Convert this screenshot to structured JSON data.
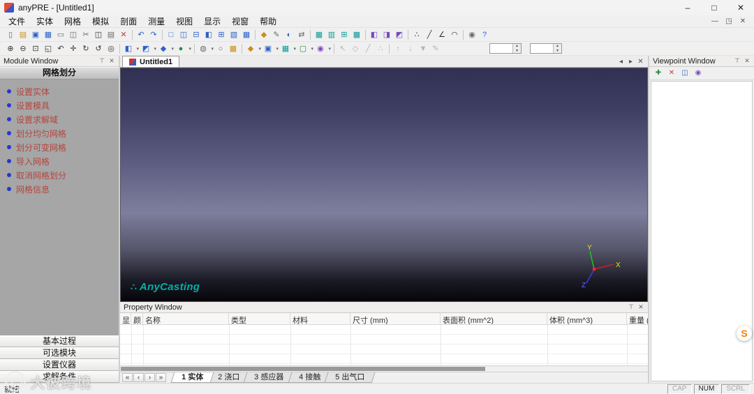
{
  "window": {
    "title": "anyPRE - [Untitled1]",
    "controls": {
      "minimize": "–",
      "maximize": "□",
      "close": "✕"
    }
  },
  "menu": {
    "items": [
      "文件",
      "实体",
      "网格",
      "模拟",
      "剖面",
      "测量",
      "视图",
      "显示",
      "视窗",
      "帮助"
    ],
    "mdi_controls": {
      "minimize": "—",
      "restore": "◳",
      "close": "✕"
    }
  },
  "toolbar1": {
    "items": [
      {
        "name": "new-file-icon",
        "g": "▯",
        "cls": "tb-icon c-dim",
        "ia": "true"
      },
      {
        "name": "open-file-icon",
        "g": "▤",
        "cls": "tb-icon c-yellow",
        "ia": "true"
      },
      {
        "name": "save-icon",
        "g": "▣",
        "cls": "tb-icon c-blue",
        "ia": "true"
      },
      {
        "name": "save-all-icon",
        "g": "▦",
        "cls": "tb-icon c-blue",
        "ia": "true"
      },
      {
        "name": "print-icon",
        "g": "▭",
        "cls": "tb-icon c-dim",
        "ia": "true"
      },
      {
        "name": "print-preview-icon",
        "g": "◫",
        "cls": "tb-icon c-dim",
        "ia": "true"
      },
      {
        "name": "cut-icon",
        "g": "✂",
        "cls": "tb-icon c-dim",
        "ia": "true"
      },
      {
        "name": "copy-icon",
        "g": "◫",
        "cls": "tb-icon c-dark",
        "ia": "true"
      },
      {
        "name": "paste-icon",
        "g": "▤",
        "cls": "tb-icon c-dim",
        "ia": "true"
      },
      {
        "name": "delete-icon",
        "g": "✕",
        "cls": "tb-icon c-red",
        "ia": "true"
      },
      {
        "name": "toolbar-separator",
        "g": "",
        "cls": "tb-sep",
        "ia": "false"
      },
      {
        "name": "undo-icon",
        "g": "↶",
        "cls": "tb-icon c-blue",
        "ia": "true"
      },
      {
        "name": "redo-icon",
        "g": "↷",
        "cls": "tb-icon c-blue",
        "ia": "true"
      },
      {
        "name": "toolbar-separator",
        "g": "",
        "cls": "tb-sep",
        "ia": "false"
      },
      {
        "name": "single-view-icon",
        "g": "□",
        "cls": "tb-icon c-blue",
        "ia": "true"
      },
      {
        "name": "two-view-vertical-icon",
        "g": "◫",
        "cls": "tb-icon c-blue",
        "ia": "true"
      },
      {
        "name": "two-view-horizontal-icon",
        "g": "⊟",
        "cls": "tb-icon c-blue",
        "ia": "true"
      },
      {
        "name": "three-view-icon",
        "g": "◧",
        "cls": "tb-icon c-blue",
        "ia": "true"
      },
      {
        "name": "four-view-icon",
        "g": "⊞",
        "cls": "tb-icon c-blue",
        "ia": "true"
      },
      {
        "name": "cascade-windows-icon",
        "g": "▧",
        "cls": "tb-icon c-blue",
        "ia": "true"
      },
      {
        "name": "tile-windows-icon",
        "g": "▦",
        "cls": "tb-icon c-blue",
        "ia": "true"
      },
      {
        "name": "toolbar-separator",
        "g": "",
        "cls": "tb-sep",
        "ia": "false"
      },
      {
        "name": "create-entity-icon",
        "g": "◆",
        "cls": "tb-icon c-yellow",
        "ia": "true"
      },
      {
        "name": "edit-entity-icon",
        "g": "✎",
        "cls": "tb-icon c-dim",
        "ia": "true"
      },
      {
        "name": "boolean-operation-icon",
        "g": "◐",
        "cls": "tb-icon c-blue",
        "ia": "true"
      },
      {
        "name": "transform-entity-icon",
        "g": "⇄",
        "cls": "tb-icon c-dim",
        "ia": "true"
      },
      {
        "name": "toolbar-separator",
        "g": "",
        "cls": "tb-sep",
        "ia": "false"
      },
      {
        "name": "uniform-mesh-icon",
        "g": "▦",
        "cls": "tb-icon c-teal",
        "ia": "true"
      },
      {
        "name": "variable-mesh-icon",
        "g": "▥",
        "cls": "tb-icon c-teal",
        "ia": "true"
      },
      {
        "name": "import-mesh-icon",
        "g": "⊞",
        "cls": "tb-icon c-teal",
        "ia": "true"
      },
      {
        "name": "mesh-info-icon",
        "g": "▩",
        "cls": "tb-icon c-teal",
        "ia": "true"
      },
      {
        "name": "toolbar-separator",
        "g": "",
        "cls": "tb-sep",
        "ia": "false"
      },
      {
        "name": "section-x-icon",
        "g": "◧",
        "cls": "tb-icon c-purple",
        "ia": "true"
      },
      {
        "name": "section-y-icon",
        "g": "◨",
        "cls": "tb-icon c-purple",
        "ia": "true"
      },
      {
        "name": "section-z-icon",
        "g": "◩",
        "cls": "tb-icon c-purple",
        "ia": "true"
      },
      {
        "name": "toolbar-separator",
        "g": "",
        "cls": "tb-sep",
        "ia": "false"
      },
      {
        "name": "measure-point-icon",
        "g": "∴",
        "cls": "tb-icon c-dark",
        "ia": "true"
      },
      {
        "name": "measure-line-icon",
        "g": "╱",
        "cls": "tb-icon c-dark",
        "ia": "true"
      },
      {
        "name": "measure-angle-icon",
        "g": "∠",
        "cls": "tb-icon c-dark",
        "ia": "true"
      },
      {
        "name": "measure-radius-icon",
        "g": "◠",
        "cls": "tb-icon c-dark",
        "ia": "true"
      },
      {
        "name": "toolbar-separator",
        "g": "",
        "cls": "tb-sep",
        "ia": "false"
      },
      {
        "name": "snapshot-icon",
        "g": "◉",
        "cls": "tb-icon c-dim",
        "ia": "true"
      },
      {
        "name": "help-icon",
        "g": "?",
        "cls": "tb-icon c-blue",
        "ia": "true"
      }
    ]
  },
  "toolbar2": {
    "spin_up": "▴",
    "spin_down": "▾",
    "items": [
      {
        "name": "zoom-in-icon",
        "g": "⊕",
        "cls": "tb-icon c-dark",
        "ia": "true"
      },
      {
        "name": "zoom-out-icon",
        "g": "⊖",
        "cls": "tb-icon c-dark",
        "ia": "true"
      },
      {
        "name": "zoom-window-icon",
        "g": "⊡",
        "cls": "tb-icon c-dark",
        "ia": "true"
      },
      {
        "name": "zoom-extents-icon",
        "g": "◱",
        "cls": "tb-icon c-dark",
        "ia": "true"
      },
      {
        "name": "zoom-previous-icon",
        "g": "↶",
        "cls": "tb-icon c-dark",
        "ia": "true"
      },
      {
        "name": "pan-icon",
        "g": "✛",
        "cls": "tb-icon c-dark",
        "ia": "true"
      },
      {
        "name": "rotate-view-icon",
        "g": "↻",
        "cls": "tb-icon c-dark",
        "ia": "true"
      },
      {
        "name": "spin-view-icon",
        "g": "↺",
        "cls": "tb-icon c-dark",
        "ia": "true"
      },
      {
        "name": "center-view-icon",
        "g": "◎",
        "cls": "tb-icon c-dark",
        "ia": "true"
      },
      {
        "name": "toolbar-separator",
        "g": "",
        "cls": "tb-sep",
        "ia": "false"
      },
      {
        "name": "front-view-icon",
        "g": "◧",
        "cls": "tb-icon dd c-blue",
        "ia": "true"
      },
      {
        "name": "top-view-icon",
        "g": "◩",
        "cls": "tb-icon dd c-blue",
        "ia": "true"
      },
      {
        "name": "iso-view-icon",
        "g": "◆",
        "cls": "tb-icon dd c-blue",
        "ia": "true"
      },
      {
        "name": "render-mode-icon",
        "g": "●",
        "cls": "tb-icon dd c-green",
        "ia": "true"
      },
      {
        "name": "toolbar-separator",
        "g": "",
        "cls": "tb-sep",
        "ia": "false"
      },
      {
        "name": "shade-mode-icon",
        "g": "◍",
        "cls": "tb-icon dd c-dim",
        "ia": "true"
      },
      {
        "name": "wireframe-icon",
        "g": "○",
        "cls": "tb-icon c-dim",
        "ia": "true"
      },
      {
        "name": "texture-icon",
        "g": "▩",
        "cls": "tb-icon c-yellow",
        "ia": "true"
      },
      {
        "name": "toolbar-separator",
        "g": "",
        "cls": "tb-sep",
        "ia": "false"
      },
      {
        "name": "display-entity-icon",
        "g": "◆",
        "cls": "tb-icon dd c-yellow",
        "ia": "true"
      },
      {
        "name": "display-mold-icon",
        "g": "▣",
        "cls": "tb-icon dd c-blue",
        "ia": "true"
      },
      {
        "name": "display-mesh-icon",
        "g": "▦",
        "cls": "tb-icon dd c-teal",
        "ia": "true"
      },
      {
        "name": "display-domain-icon",
        "g": "▢",
        "cls": "tb-icon dd c-green",
        "ia": "true"
      },
      {
        "name": "display-all-icon",
        "g": "◉",
        "cls": "tb-icon dd c-purple",
        "ia": "true"
      },
      {
        "name": "toolbar-separator",
        "g": "",
        "cls": "tb-sep",
        "ia": "false"
      },
      {
        "name": "select-entity-icon",
        "g": "↖",
        "cls": "tb-icon c-dis",
        "ia": "true"
      },
      {
        "name": "select-face-icon",
        "g": "◇",
        "cls": "tb-icon c-dis",
        "ia": "true"
      },
      {
        "name": "select-edge-icon",
        "g": "╱",
        "cls": "tb-icon c-dis",
        "ia": "true"
      },
      {
        "name": "select-vertex-icon",
        "g": "∴",
        "cls": "tb-icon c-dis",
        "ia": "true"
      },
      {
        "name": "toolbar-separator",
        "g": "",
        "cls": "tb-sep",
        "ia": "false"
      },
      {
        "name": "move-up-icon",
        "g": "↑",
        "cls": "tb-icon c-dis",
        "ia": "true"
      },
      {
        "name": "move-down-icon",
        "g": "↓",
        "cls": "tb-icon c-dis",
        "ia": "true"
      },
      {
        "name": "filter-icon",
        "g": "▼",
        "cls": "tb-icon c-dis",
        "ia": "true"
      },
      {
        "name": "edit-list-icon",
        "g": "✎",
        "cls": "tb-icon c-dis",
        "ia": "true"
      }
    ]
  },
  "module_window": {
    "title": "Module Window",
    "header": "网格划分",
    "items": [
      "设置实体",
      "设置模具",
      "设置求解域",
      "划分均匀网格",
      "划分可变网格",
      "导入网格",
      "取消网格划分",
      "网格信息"
    ],
    "bottom_buttons": [
      "基本过程",
      "可选模块",
      "设置仪器",
      "求解条件"
    ]
  },
  "viewport": {
    "tab": "Untitled1",
    "tab_controls": {
      "left": "◂",
      "right": "▸",
      "close": "✕"
    },
    "logo_mark": "∴",
    "logo": "AnyCasting",
    "axes": {
      "x": "X",
      "y": "Y",
      "z": "Z"
    }
  },
  "viewpoint_window": {
    "title": "Viewpoint Window",
    "toolbar": [
      {
        "name": "new-viewpoint-icon",
        "g": "✚",
        "cls": "vp-icon c-green",
        "ia": "true"
      },
      {
        "name": "delete-viewpoint-icon",
        "g": "✕",
        "cls": "vp-icon c-red",
        "ia": "true"
      },
      {
        "name": "copy-viewpoint-icon",
        "g": "◫",
        "cls": "vp-icon c-blue",
        "ia": "true"
      },
      {
        "name": "capture-viewpoint-icon",
        "g": "◉",
        "cls": "vp-icon c-purple",
        "ia": "true"
      }
    ]
  },
  "property_window": {
    "title": "Property Window",
    "columns": [
      "显",
      "颜",
      "名称",
      "类型",
      "材料",
      "尺寸 (mm)",
      "表面积 (mm^2)",
      "体积 (mm^3)",
      "重量 (g)"
    ],
    "nav": {
      "first": "«",
      "prev": "‹",
      "next": "›",
      "last": "»"
    },
    "tabs": [
      {
        "label": "1 实体",
        "name": "sheet-tab-entity",
        "cls": "sheet-tab active",
        "ia": "true"
      },
      {
        "label": "2 浇口",
        "name": "sheet-tab-gate",
        "cls": "sheet-tab",
        "ia": "true"
      },
      {
        "label": "3 感应器",
        "name": "sheet-tab-sensor",
        "cls": "sheet-tab",
        "ia": "true"
      },
      {
        "label": "4 接触",
        "name": "sheet-tab-contact",
        "cls": "sheet-tab",
        "ia": "true"
      },
      {
        "label": "5 出气口",
        "name": "sheet-tab-vent",
        "cls": "sheet-tab",
        "ia": "true"
      }
    ]
  },
  "status_bar": {
    "ready": "就绪",
    "indicators": [
      "CAP",
      "NUM",
      "SCRL"
    ]
  },
  "watermark": {
    "text": "大彼跨境"
  },
  "overlay": {
    "badge": "S"
  },
  "icons": {
    "pin": "⊤",
    "close": "✕"
  },
  "colors": {
    "accent_blue": "#2f62c4",
    "module_item_red": "#b5453d",
    "bullet_blue": "#2439c8",
    "brand_teal": "#00b2a9",
    "badge_orange": "#ff7a00",
    "viewport_top": "#303052",
    "viewport_mid": "#7e7e9e",
    "viewport_bottom": "#05050a",
    "panel_gray": "#a6a6a6"
  }
}
